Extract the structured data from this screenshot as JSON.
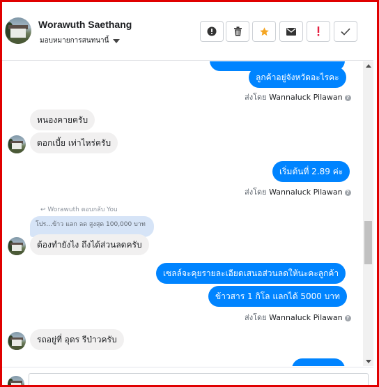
{
  "header": {
    "name": "Worawuth Saethang",
    "assign_label": "มอบหมายการสนทนานี้",
    "buttons": [
      {
        "icon": "exclamation-circle-icon"
      },
      {
        "icon": "trash-icon"
      },
      {
        "icon": "star-icon"
      },
      {
        "icon": "envelope-icon"
      },
      {
        "icon": "red-exclamation-icon"
      },
      {
        "icon": "checkmark-icon"
      }
    ]
  },
  "messages": {
    "m1": "ลูกค้าอยู่จังหวัดอะไรคะ",
    "sent1_prefix": "ส่งโดย",
    "sent1_name": "Wannaluck Pilawan",
    "m2": "หนองคายครับ",
    "m3": "ดอกเบี้ย เท่าไหร่ครับ",
    "m4": "เริ่มต้นที่ 2.89 ค่ะ",
    "sent2_prefix": "ส่งโดย",
    "sent2_name": "Wannaluck Pilawan",
    "reply_meta": "Worawuth ตอบกลับ You",
    "quoted": "โปร...ข้าว แลก ลด สูงสุด 100,000 บาท",
    "m5": "ต้องทำยังไง ถึงได้ส่วนลดครับ",
    "m6": "เซลล์จะคุยรายละเอียดเสนอส่วนลดให้นะคะลูกค้า",
    "m7": "ข้าวสาร 1 กิโล แลกได้ 5000  บาท",
    "sent3_prefix": "ส่งโดย",
    "sent3_name": "Wannaluck Pilawan",
    "m8": "รถอยู่ที่ อุดร รีป่าวครับ"
  },
  "colors": {
    "outgoing": "#0084ff",
    "incoming": "#f1f0f0",
    "star": "#f5a623",
    "alert": "#e41e3f",
    "frame": "#e00000"
  }
}
